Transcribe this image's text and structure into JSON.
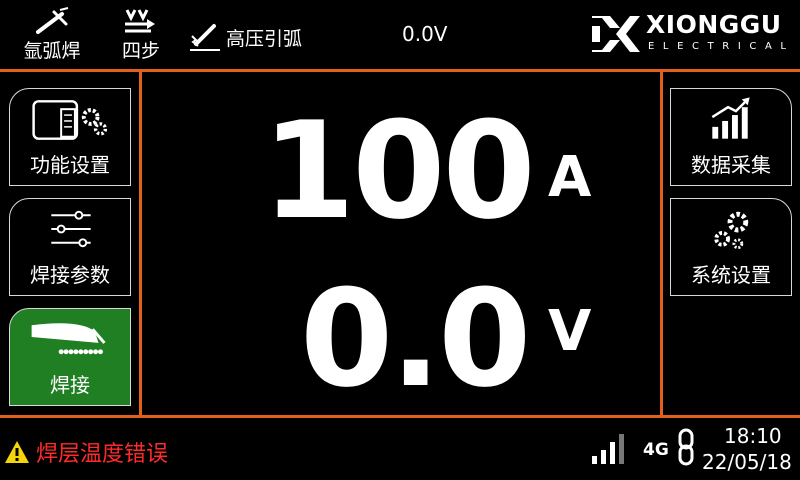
{
  "topbar": {
    "mode_weld": "氩弧焊",
    "mode_step": "四步",
    "mode_arc": "高压引弧",
    "voltage": "0.0V",
    "logo_brand": "XIONGGU",
    "logo_sub": "ELECTRICAL"
  },
  "left_menu": [
    {
      "label": "功能设置",
      "icon": "machine-settings-icon"
    },
    {
      "label": "焊接参数",
      "icon": "sliders-icon"
    },
    {
      "label": "焊接",
      "icon": "torch-icon",
      "active": true
    }
  ],
  "right_menu": [
    {
      "label": "数据采集",
      "icon": "bar-chart-icon"
    },
    {
      "label": "系统设置",
      "icon": "gears-icon"
    }
  ],
  "readout": {
    "current_value": "100",
    "current_unit": "A",
    "voltage_value": "0.0",
    "voltage_unit": "V"
  },
  "status": {
    "warning": "焊层温度错误",
    "network": "4G",
    "time": "18:10",
    "date": "22/05/18"
  },
  "colors": {
    "accent": "#e2601c",
    "active_button": "#1f7f22",
    "warning": "#ff2a2a",
    "warning_icon": "#f5d50a"
  }
}
